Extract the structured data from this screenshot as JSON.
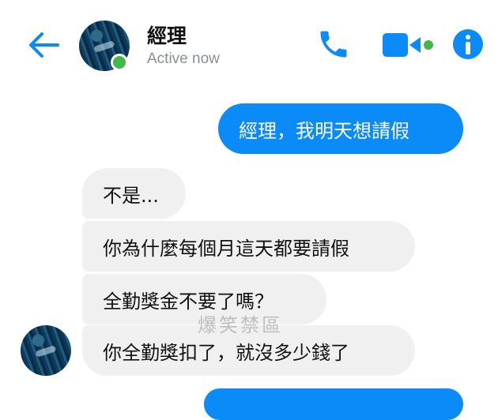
{
  "header": {
    "contact_name": "經理",
    "status": "Active now",
    "icons": [
      "back-arrow-icon",
      "avatar",
      "phone-icon",
      "video-camera-icon",
      "info-icon"
    ]
  },
  "messages": [
    {
      "direction": "outgoing",
      "text": "經理，我明天想請假"
    },
    {
      "direction": "incoming",
      "text": "不是..."
    },
    {
      "direction": "incoming",
      "text": "你為什麼每個月這天都要請假"
    },
    {
      "direction": "incoming",
      "text": "全勤獎金不要了嗎？"
    },
    {
      "direction": "incoming",
      "text": "你全勤獎扣了，就沒多少錢了"
    },
    {
      "direction": "outgoing",
      "text": ""
    }
  ],
  "watermark": "爆笑禁區",
  "colors": {
    "accent": "#0a8bf7",
    "incoming_bubble": "#f0f0f1",
    "online": "#44b74a",
    "status_text": "#8a8d91"
  }
}
